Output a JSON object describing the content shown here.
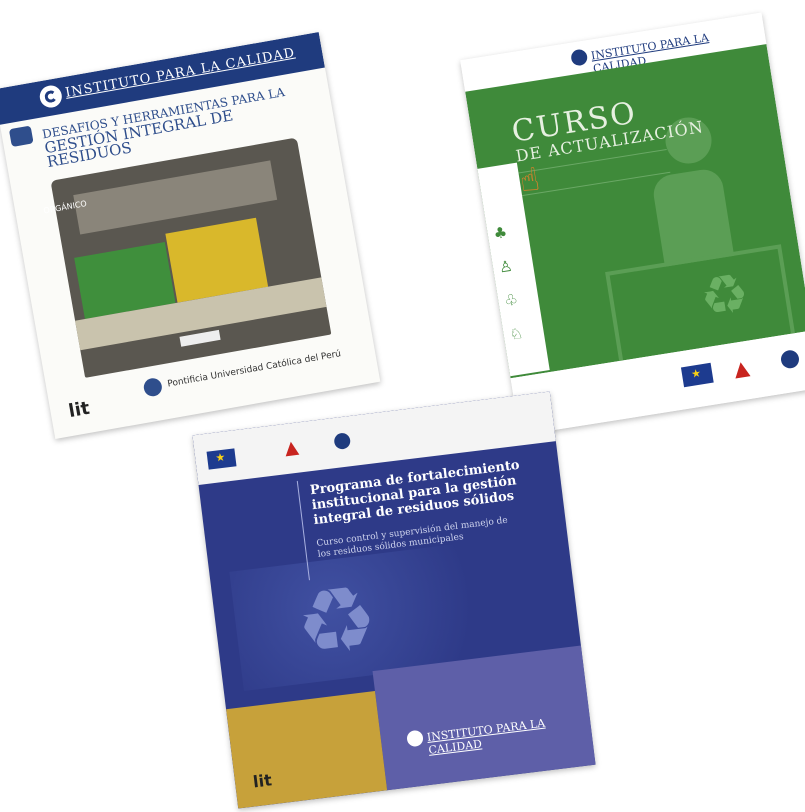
{
  "cover1": {
    "header": "INSTITUTO PARA LA CALIDAD",
    "title_line1": "DESAFIOS Y HERRAMIENTAS PARA LA",
    "title_line2": "GESTIÓN INTEGRAL DE RESIDUOS",
    "bin_label": "ORGÁNICO",
    "university": "Pontificia Universidad Católica del Perú",
    "footer_logo": "lit"
  },
  "cover2": {
    "header": "INSTITUTO PARA LA CALIDAD",
    "title_big": "CURSO",
    "title_sub": "DE ACTUALIZACIÓN"
  },
  "cover3": {
    "title": "Programa de fortalecimiento institucional para la gestión integral de residuos sólidos",
    "subtitle": "Curso control y supervisión del manejo de los residuos sólidos municipales",
    "footer": "INSTITUTO PARA LA CALIDAD",
    "footer_logo": "lit"
  }
}
